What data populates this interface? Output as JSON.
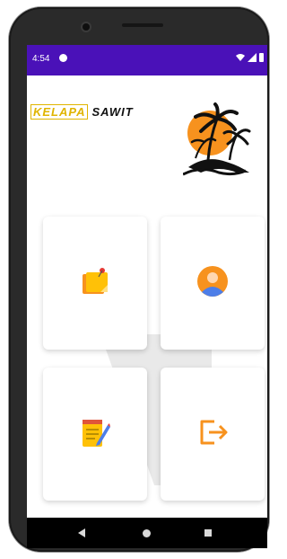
{
  "status_bar": {
    "time": "4:54",
    "color": "#4a11b8"
  },
  "header": {
    "logo_word_1": "KELAPA",
    "logo_word_2": "SAWIT",
    "logo_accent": "#e0b400"
  },
  "menu": {
    "cards": [
      {
        "icon": "sticky-note-icon"
      },
      {
        "icon": "user-profile-icon"
      },
      {
        "icon": "notepad-pencil-icon"
      },
      {
        "icon": "logout-icon"
      }
    ]
  },
  "colors": {
    "orange": "#f7921e",
    "note_yellow": "#ffc107",
    "profile_blue": "#4d7ee8"
  }
}
